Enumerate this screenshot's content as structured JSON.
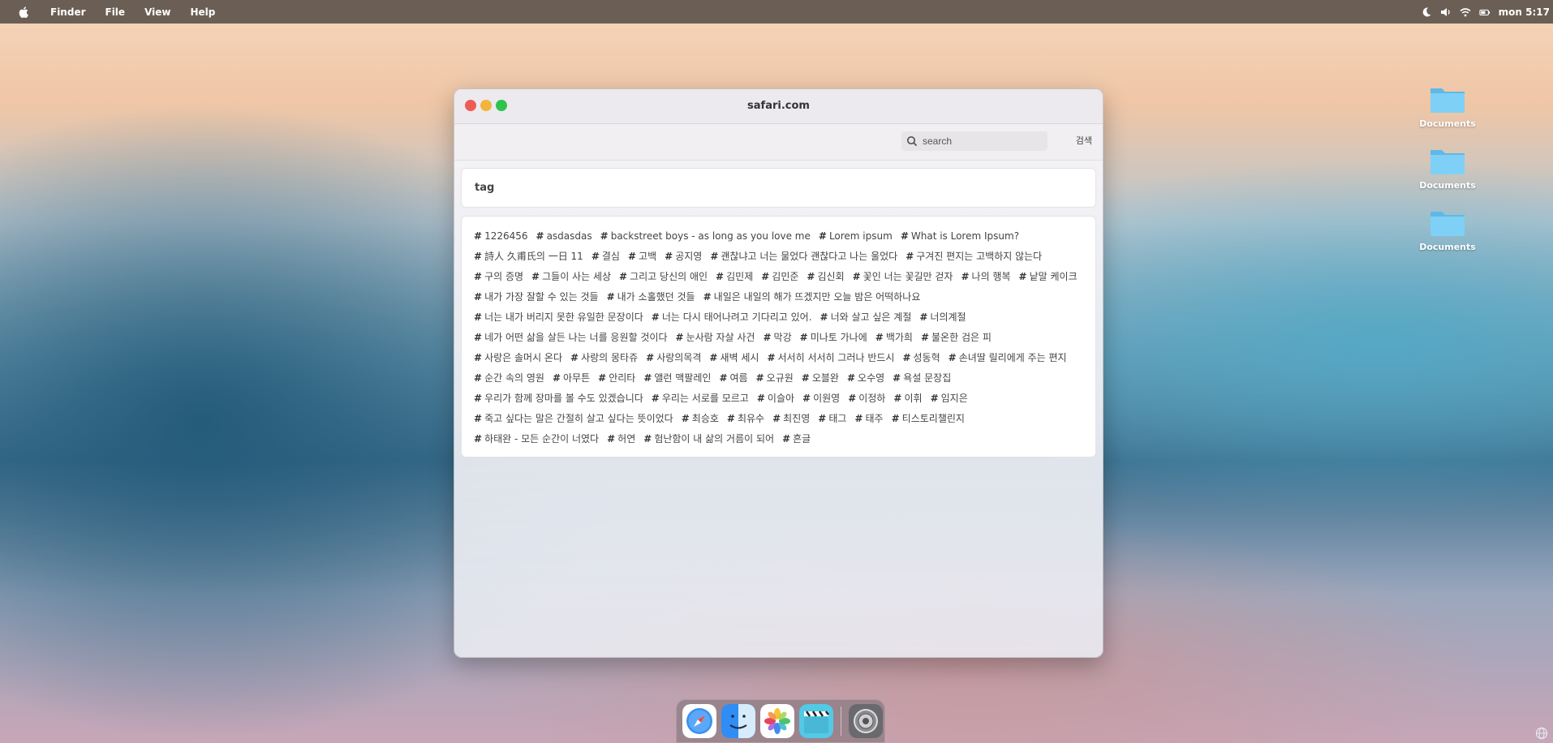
{
  "menubar": {
    "items": [
      "Finder",
      "File",
      "View",
      "Help"
    ],
    "clock": "mon 5:17"
  },
  "window": {
    "title": "safari.com",
    "search": {
      "placeholder": "search",
      "button_label": "검색"
    },
    "section_title": "tag",
    "tags": [
      "1226456",
      "asdasdas",
      "backstreet boys - as long as you love me",
      "Lorem ipsum",
      "What is Lorem Ipsum?",
      "詩人 久甫氏의 一日 11",
      "결심",
      "고백",
      "공지영",
      "괜찮냐고 너는 물었다 괜찮다고 나는 울었다",
      "구겨진 편지는 고백하지 않는다",
      "구의 증명",
      "그들이 사는 세상",
      "그리고 당신의 애인",
      "김민제",
      "김민준",
      "김신회",
      "꽃인 너는 꽃길만 걷자",
      "나의 행복",
      "낱말 케이크",
      "내가 가장 잘할 수 있는 것들",
      "내가 소홀했던 것들",
      "내일은 내일의 해가 뜨겠지만 오늘 밤은 어떡하나요",
      "너는 내가 버리지 못한 유일한 문장이다",
      "너는 다시 태어나려고 기다리고 있어.",
      "너와 살고 싶은 계절",
      "너의계절",
      "네가 어떤 삶을 살든 나는 너를 응원할 것이다",
      "눈사람 자살 사건",
      "막강",
      "미나토 가나에",
      "백가희",
      "불온한 검은 피",
      "사랑은 솔머시 온다",
      "사랑의 몽타쥬",
      "사랑의목격",
      "새벽 세시",
      "서서히 서서히 그러나 반드시",
      "성동혁",
      "손녀딸 릴리에게 주는 편지",
      "순간 속의 영원",
      "아무튼",
      "안리타",
      "앨런 맥팔레인",
      "여름",
      "오규원",
      "오블완",
      "오수영",
      "욕설 문장집",
      "우리가 함께 장마를 볼 수도 있겠습니다",
      "우리는 서로를 모르고",
      "이슬아",
      "이원영",
      "이정하",
      "이휘",
      "임지은",
      "죽고 싶다는 말은 간절히 살고 싶다는 뜻이었다",
      "최승호",
      "최유수",
      "최진영",
      "태그",
      "태주",
      "티스토리챌린지",
      "하태완 - 모든 순간이 너였다",
      "허연",
      "험난함이 내 삶의 거름이 되어",
      "흔글"
    ]
  },
  "desktop": {
    "icons": [
      {
        "label": "Documents",
        "icon": "folder-icon"
      },
      {
        "label": "Documents",
        "icon": "folder-icon"
      },
      {
        "label": "Documents",
        "icon": "folder-icon"
      }
    ]
  },
  "dock": {
    "apps": [
      "safari-icon",
      "finder-icon",
      "photos-icon",
      "clips-icon",
      "settings-icon"
    ]
  },
  "colors": {
    "menubar": "#6b5f55",
    "close": "#ee5b55",
    "minimize": "#f4b43c",
    "maximize": "#2fc24c",
    "folder": "#6cc6f0"
  }
}
